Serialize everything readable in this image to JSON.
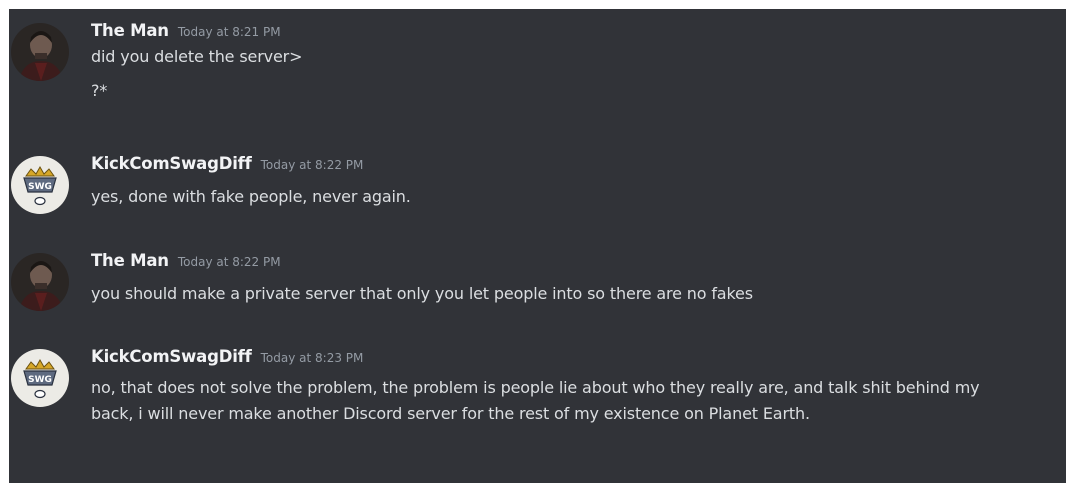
{
  "messages": [
    {
      "author": "The Man",
      "time": "Today at 8:21 PM",
      "lines": [
        "did you delete the server>",
        "?*"
      ]
    },
    {
      "author": "KickComSwagDiff",
      "time": "Today at 8:22 PM",
      "lines": [
        "yes, done with fake people, never again."
      ]
    },
    {
      "author": "The Man",
      "time": "Today at 8:22 PM",
      "lines": [
        "you should make a private server that only you let people into so there are no fakes"
      ]
    },
    {
      "author": "KickComSwagDiff",
      "time": "Today at 8:23 PM",
      "text": "no, that does not solve the problem, the problem is people lie about who they really are, and talk shit behind my back, i will never make another Discord server for the rest of my existence on Planet Earth."
    }
  ],
  "colors": {
    "background": "#313338",
    "username": "#f2f3f5",
    "timestamp": "#949ba4",
    "message_text": "#dbdee1"
  },
  "icons": {
    "avatar_the_man": "dark-portrait-avatar",
    "avatar_kickcom": "swag-crown-badge-avatar"
  }
}
